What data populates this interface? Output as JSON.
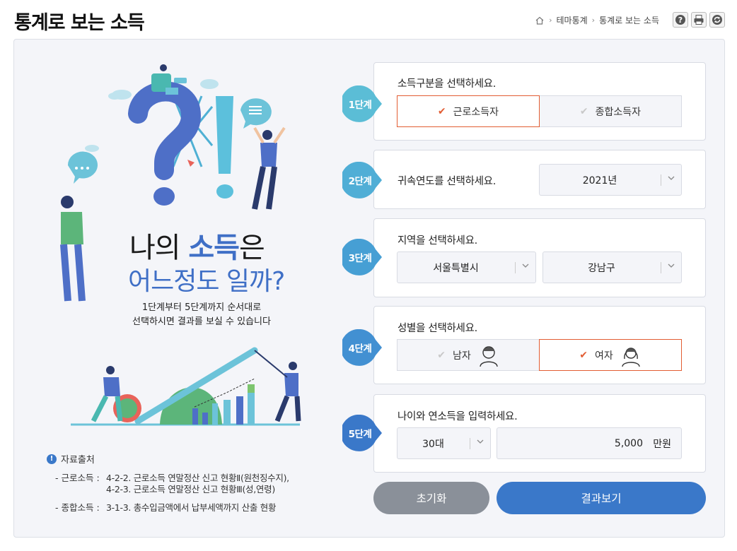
{
  "page": {
    "title": "통계로 보는 소득"
  },
  "breadcrumb": {
    "items": [
      "테마통계",
      "통계로 보는 소득"
    ]
  },
  "tools": [
    "help-icon",
    "print-icon",
    "refresh-icon"
  ],
  "hero": {
    "line1_pre": "나의 ",
    "line1_accent": "소득",
    "line1_post": "은",
    "line2": "어느정도 일까?",
    "desc_line1": "1단계부터 5단계까지 순서대로",
    "desc_line2": "선택하시면 결과를 보실 수 있습니다"
  },
  "source": {
    "title": "자료출처",
    "labor_label": "- 근로소득 :",
    "labor_line1": "4-2-2. 근로소득 연말정산 신고 현황Ⅱ(원천징수지),",
    "labor_line2": "4-2-3. 근로소득 연말정산 신고 현황Ⅲ(성,연령)",
    "total_label": "- 종합소득 :",
    "total_line1": "3-1-3. 총수입금액에서 납부세액까지 산출 현황"
  },
  "steps": {
    "s1": {
      "badge": "1단계",
      "question": "소득구분을 선택하세요.",
      "opt1": "근로소득자",
      "opt2": "종합소득자",
      "selected": "근로소득자"
    },
    "s2": {
      "badge": "2단계",
      "question": "귀속연도를 선택하세요.",
      "year": "2021년"
    },
    "s3": {
      "badge": "3단계",
      "question": "지역을 선택하세요.",
      "region": "서울특별시",
      "district": "강남구"
    },
    "s4": {
      "badge": "4단계",
      "question": "성별을 선택하세요.",
      "opt1": "남자",
      "opt2": "여자",
      "selected": "여자"
    },
    "s5": {
      "badge": "5단계",
      "question": "나이와 연소득을 입력하세요.",
      "age": "30대",
      "income": "5,000",
      "unit": "만원"
    }
  },
  "buttons": {
    "reset": "초기화",
    "result": "결과보기"
  },
  "colors": {
    "accent_blue": "#3a78c9",
    "selected_orange": "#e25d33",
    "step_badge_1": "#5bbdd6",
    "step_badge_5": "#3a78c9"
  }
}
